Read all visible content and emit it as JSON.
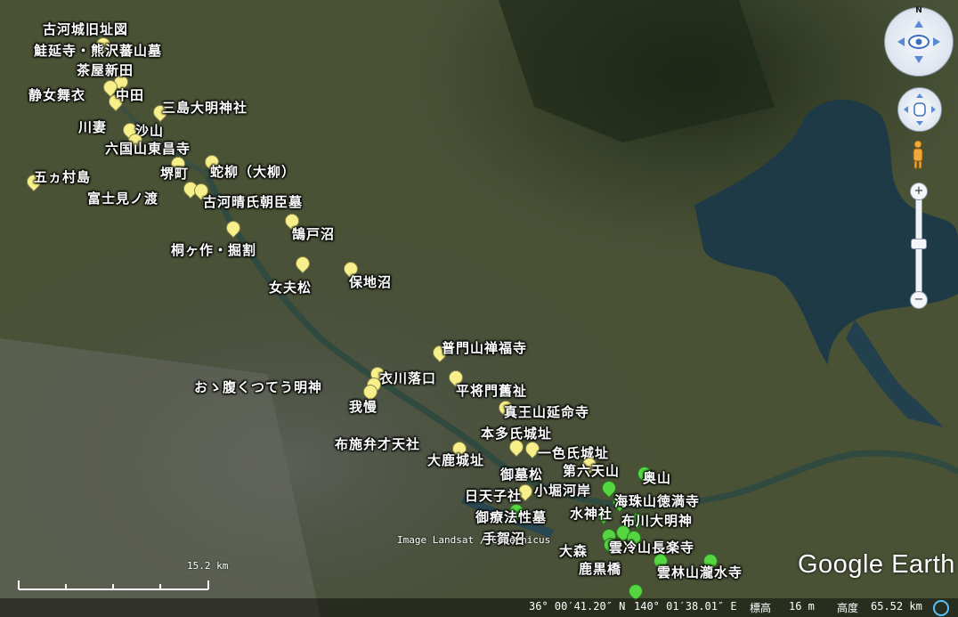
{
  "places": [
    {
      "name": "古河城旧址図",
      "pin": "yellow"
    },
    {
      "name": "鮭延寺・熊沢蕃山墓",
      "pin": "yellow"
    },
    {
      "name": "茶屋新田",
      "pin": "yellow"
    },
    {
      "name": "静女舞衣",
      "pin": "yellow"
    },
    {
      "name": "中田",
      "pin": "yellow"
    },
    {
      "name": "三島大明神社",
      "pin": "yellow"
    },
    {
      "name": "川妻",
      "pin": "yellow"
    },
    {
      "name": "沙山",
      "pin": "yellow"
    },
    {
      "name": "六国山東昌寺",
      "pin": "yellow"
    },
    {
      "name": "五ヵ村島",
      "pin": "yellow"
    },
    {
      "name": "堺町",
      "pin": "yellow"
    },
    {
      "name": "蛇柳（大柳）",
      "pin": "yellow"
    },
    {
      "name": "富士見ノ渡",
      "pin": "yellow"
    },
    {
      "name": "古河晴氏朝臣墓",
      "pin": "yellow"
    },
    {
      "name": "鵠戸沼",
      "pin": "yellow"
    },
    {
      "name": "桐ヶ作・掘割",
      "pin": "yellow"
    },
    {
      "name": "女夫松",
      "pin": "yellow"
    },
    {
      "name": "保地沼",
      "pin": "yellow"
    },
    {
      "name": "普門山禅福寺",
      "pin": "yellow"
    },
    {
      "name": "衣川落口",
      "pin": "yellow"
    },
    {
      "name": "おゝ腹くつてう明神",
      "pin": "yellow"
    },
    {
      "name": "平将門舊祉",
      "pin": "yellow"
    },
    {
      "name": "我慢",
      "pin": "yellow"
    },
    {
      "name": "真王山延命寺",
      "pin": "yellow"
    },
    {
      "name": "本多氏城址",
      "pin": "yellow"
    },
    {
      "name": "布施弁才天社",
      "pin": "yellow"
    },
    {
      "name": "一色氏城址",
      "pin": "yellow"
    },
    {
      "name": "大鹿城址",
      "pin": "yellow"
    },
    {
      "name": "御墓松",
      "pin": "yellow"
    },
    {
      "name": "第六天山",
      "pin": "yellow"
    },
    {
      "name": "奥山",
      "pin": "green"
    },
    {
      "name": "小堀河岸",
      "pin": "green"
    },
    {
      "name": "日天子社",
      "pin": "yellow"
    },
    {
      "name": "海珠山徳満寺",
      "pin": "green"
    },
    {
      "name": "御療法性墓",
      "pin": "green"
    },
    {
      "name": "水神社",
      "pin": "green"
    },
    {
      "name": "布川大明神",
      "pin": "green"
    },
    {
      "name": "手賀沼",
      "pin": "green"
    },
    {
      "name": "大森",
      "pin": "green"
    },
    {
      "name": "雲冷山長楽寺",
      "pin": "green"
    },
    {
      "name": "鹿黒橋",
      "pin": "green"
    },
    {
      "name": "雲林山瀧水寺",
      "pin": "green"
    },
    {
      "name": "",
      "pin": "green"
    }
  ],
  "attribution": "Image Landsat / Copernicus",
  "logo": "Google Earth",
  "scale_label": "15.2 km",
  "status": {
    "latitude": "36° 00′41.20″ N",
    "longitude": "140° 01′38.01″ E",
    "elevation_label": "標高",
    "elevation": "16 m",
    "altitude_label": "高度",
    "altitude": "65.52 km"
  },
  "controls": {
    "north": "N",
    "zoom_in": "+",
    "zoom_out": "−"
  },
  "colors": {
    "pin_yellow": "#f7f08a",
    "pin_green": "#55d640",
    "water": "#1f3a47"
  }
}
